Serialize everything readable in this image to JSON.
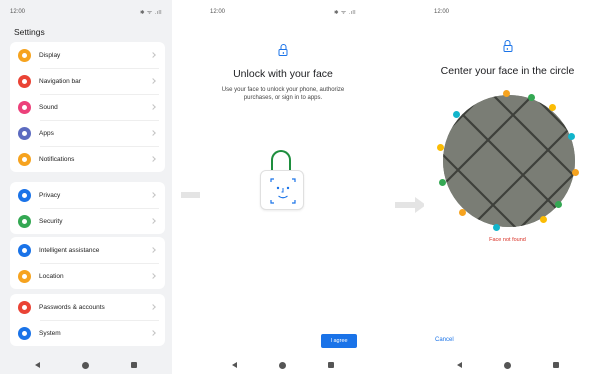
{
  "phone1": {
    "status": {
      "time": "12:00",
      "icons": "✱ ᯤ .ıll"
    },
    "title": "Settings",
    "groups": [
      [
        {
          "label": "Display",
          "icon": "display-icon",
          "color": "#f6a31f"
        },
        {
          "label": "Navigation bar",
          "icon": "navigation-bar-icon",
          "color": "#ea4335"
        },
        {
          "label": "Sound",
          "icon": "sound-icon",
          "color": "#ec407a"
        },
        {
          "label": "Apps",
          "icon": "apps-icon",
          "color": "#5c6bc0"
        },
        {
          "label": "Notifications",
          "icon": "notifications-icon",
          "color": "#f6a31f"
        }
      ],
      [
        {
          "label": "Privacy",
          "icon": "privacy-icon",
          "color": "#1a73e8"
        },
        {
          "label": "Security",
          "icon": "security-icon",
          "color": "#34a853"
        }
      ],
      [
        {
          "label": "Intelligent assistance",
          "icon": "intelligent-assistance-icon",
          "color": "#1a73e8"
        },
        {
          "label": "Location",
          "icon": "location-icon",
          "color": "#f6a31f"
        }
      ],
      [
        {
          "label": "Passwords & accounts",
          "icon": "passwords-accounts-icon",
          "color": "#ea4335"
        },
        {
          "label": "System",
          "icon": "system-icon",
          "color": "#1a73e8"
        }
      ]
    ]
  },
  "phone2": {
    "status": {
      "time": "12:00",
      "icons": "✱ ᯤ .ıll"
    },
    "title": "Unlock with your face",
    "subtitle": "Use your face to unlock your phone, authorize purchases, or sign in to apps.",
    "agree_label": "I agree"
  },
  "phone3": {
    "status": {
      "time": "12:00"
    },
    "title": "Center your face in the circle",
    "message": "Face not found",
    "cancel_label": "Cancel"
  },
  "colors": {
    "accent": "#1a73e8",
    "success": "#1e8e3e",
    "error": "#d93025"
  }
}
